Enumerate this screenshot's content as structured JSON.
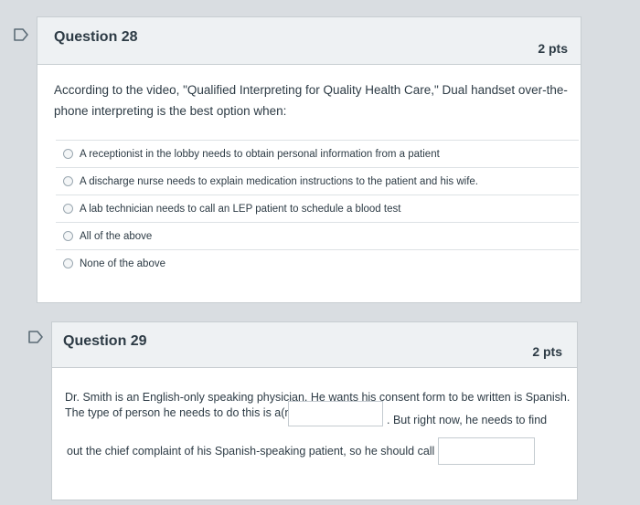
{
  "questions": [
    {
      "title": "Question 28",
      "points": "2 pts",
      "prompt_line1": "According to the video, \"Qualified Interpreting for Quality Health Care,\" Dual handset over-the-",
      "prompt_line2": "phone interpreting is the best option when:",
      "answers": [
        "A receptionist in the lobby needs to obtain personal information from a patient",
        "A discharge nurse needs to explain medication instructions to the patient and his wife.",
        "A lab technician needs to call an LEP patient to schedule a blood test",
        "All of the above",
        "None of the above"
      ]
    },
    {
      "title": "Question 29",
      "points": "2 pts",
      "line1": "Dr. Smith is an English-only speaking physician. He wants his consent form to be written is Spanish.",
      "line2_before": "The type of person he needs to do this is a(n)",
      "line2_after": ". But right now, he needs to find",
      "line3": "out the chief complaint of his Spanish-speaking patient, so he should call a(n)",
      "blank1_value": "",
      "blank2_value": ""
    }
  ]
}
